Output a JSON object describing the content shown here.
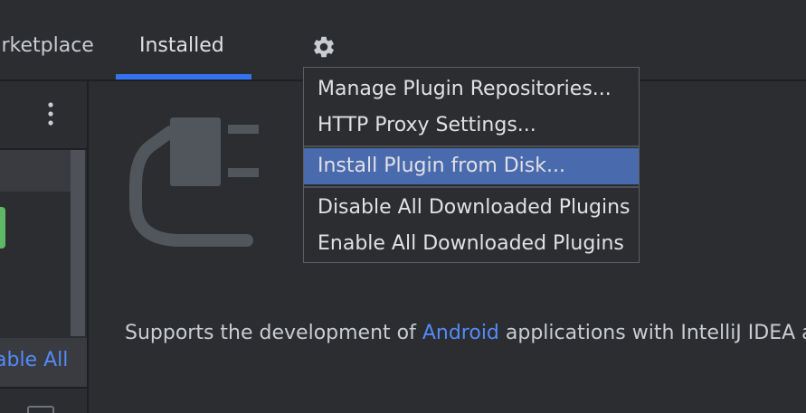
{
  "tabs": [
    {
      "label": "arketplace"
    },
    {
      "label": "Installed"
    }
  ],
  "left_panel": {
    "enable_all_label": "able All"
  },
  "popup_menu": {
    "groups": [
      [
        "Manage Plugin Repositories...",
        "HTTP Proxy Settings..."
      ],
      [
        "Install Plugin from Disk..."
      ],
      [
        "Disable All Downloaded Plugins",
        "Enable All Downloaded Plugins"
      ]
    ],
    "items": {
      "manage_repos": "Manage Plugin Repositories...",
      "http_proxy": "HTTP Proxy Settings...",
      "install_from_disk": "Install Plugin from Disk...",
      "disable_all": "Disable All Downloaded Plugins",
      "enable_all": "Enable All Downloaded Plugins"
    },
    "selected_item": "Install Plugin from Disk..."
  },
  "description": {
    "prefix": "Supports the development of ",
    "link": "Android",
    "suffix": " applications with IntelliJ IDEA an"
  },
  "icons": {
    "settings": "gear-icon",
    "more": "kebab-icon",
    "plugin": "plug-icon"
  },
  "colors": {
    "accent": "#3574f0",
    "link": "#548af7",
    "selection": "#4a6aae",
    "background": "#2b2d30",
    "badge_green": "#5fb865"
  }
}
